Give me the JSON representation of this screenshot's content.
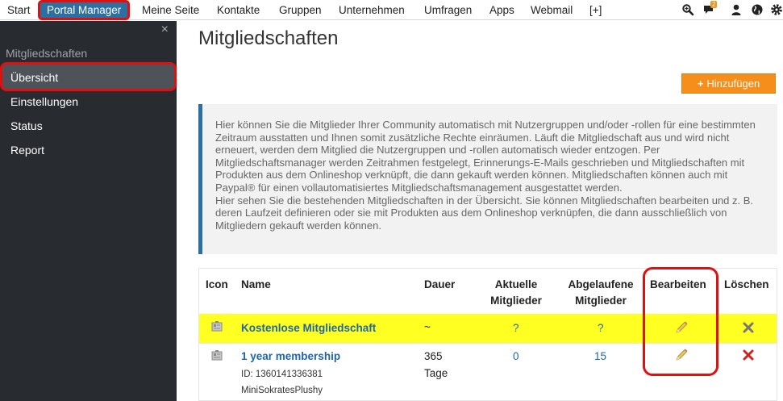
{
  "topnav": {
    "items": [
      "Start",
      "Portal Manager",
      "Meine Seite",
      "Kontakte",
      "Gruppen",
      "Unternehmen",
      "Umfragen",
      "Apps",
      "Webmail",
      "[+]"
    ],
    "notification_count": "2",
    "icons": [
      "search-icon",
      "chat-icon",
      "user-icon",
      "globe-icon",
      "gear-icon"
    ]
  },
  "sidebar": {
    "close_symbol": "×",
    "title": "Mitgliedschaften",
    "items": [
      "Übersicht",
      "Einstellungen",
      "Status",
      "Report"
    ]
  },
  "main": {
    "title": "Mitgliedschaften",
    "add_button": "Hinzufügen",
    "info_text": "Hier können Sie die Mitglieder Ihrer Community automatisch mit Nutzergruppen und/oder -rollen für eine bestimmten Zeitraum ausstatten und Ihnen somit zusätzliche Rechte einräumen. Läuft die Mitgliedschaft aus und wird nicht erneuert, werden dem Mitglied die Nutzergruppen und -rollen automatisch wieder entzogen. Per Mitgliedschaftsmanager werden Zeitrahmen festgelegt, Erinnerungs-E-Mails geschrieben und Mitgliedschaften mit Produkten aus dem Onlineshop verknüpft, die dann gekauft werden können. Mitgliedschaften können auch mit Paypal® für einen vollautomatisiertes Mitgliedschaftsmanagement ausgestattet werden.",
    "info_text2": "Hier sehen Sie die bestehenden Mitgliedschaften in der Übersicht. Sie können Mitgliedschaften bearbeiten und z. B. deren Laufzeit definieren oder sie mit Produkten aus dem Onlineshop verknüpfen, die dann ausschließlich von Mitgliedern gekauft werden können."
  },
  "table": {
    "headers": {
      "icon": "Icon",
      "name": "Name",
      "dauer": "Dauer",
      "aktuelle_1": "Aktuelle",
      "aktuelle_2": "Mitglieder",
      "abgelaufene_1": "Abgelaufene",
      "abgelaufene_2": "Mitglieder",
      "bearbeiten": "Bearbeiten",
      "loeschen": "Löschen"
    },
    "rows": [
      {
        "name": "Kostenlose Mitgliedschaft",
        "dauer": "~",
        "aktuelle": "?",
        "abgelaufene": "?",
        "highlight_color": "#ffff22"
      },
      {
        "name": "1 year membership",
        "id": "ID: 1360141336381",
        "product": "MiniSokratesPlushy",
        "dauer_1": "365",
        "dauer_2": "Tage",
        "aktuelle": "0",
        "abgelaufene": "15"
      }
    ]
  },
  "colors": {
    "accent_blue": "#2c6fa0",
    "link_blue": "#1e66a8",
    "sidebar_bg": "#282b30",
    "button_orange": "#f58e1b",
    "annotation_red": "#e01010",
    "delete_red": "#d22020"
  }
}
